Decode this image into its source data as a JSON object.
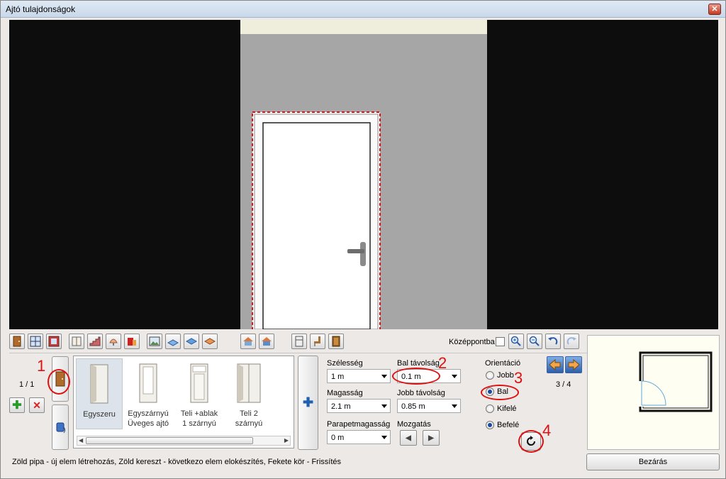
{
  "window": {
    "title": "Ajtó tulajdonságok",
    "close_glyph": "✕"
  },
  "toolbar": {
    "icons": [
      "door-icon",
      "window-icon",
      "bay-window-icon",
      "cabinet-icon",
      "stairs-icon",
      "lamp-icon",
      "furniture-icon",
      "picture-icon",
      "floor-tile-icon",
      "ceiling-tile-icon",
      "wall-tile-icon",
      "roof-icon",
      "roof-window-icon",
      "fridge-icon",
      "chair-icon",
      "door-small-icon"
    ],
    "center_label": "Középpontba",
    "center_checked": false,
    "right_icons": [
      "zoom-in-icon",
      "zoom-out-icon",
      "undo-icon",
      "redo-icon"
    ]
  },
  "left_panel": {
    "counter": "1 / 1",
    "add_icon": "plus-icon",
    "delete_icon": "delete-x-icon"
  },
  "gallery": {
    "items": [
      {
        "label": "Egyszeru",
        "selected": true
      },
      {
        "label": "Egyszárnyú\nÜveges ajtó",
        "selected": false
      },
      {
        "label": "Teli +ablak\n1 szárnyú",
        "selected": false
      },
      {
        "label": "Teli 2\nszárnyú",
        "selected": false
      }
    ]
  },
  "fields": {
    "width_label": "Szélesség",
    "width_value": "1 m",
    "left_dist_label": "Bal távolság",
    "left_dist_value": "0.1 m",
    "height_label": "Magasság",
    "height_value": "2.1 m",
    "right_dist_label": "Jobb távolság",
    "right_dist_value": "0.85 m",
    "sill_label": "Parapetmagasság",
    "sill_value": "0 m",
    "move_label": "Mozgatás"
  },
  "orientation": {
    "title": "Orientáció",
    "options": [
      {
        "label": "Jobb",
        "checked": false
      },
      {
        "label": "Bal",
        "checked": true
      },
      {
        "label": "Kifelé",
        "checked": false
      },
      {
        "label": "Befelé",
        "checked": true
      }
    ]
  },
  "nav": {
    "counter": "3 / 4"
  },
  "callouts": {
    "c1": "1",
    "c2": "2",
    "c3": "3",
    "c4": "4"
  },
  "status": {
    "text": "Zöld pipa - új elem létrehozás, Zöld kereszt - következo elem elokészítés, Fekete kör - Frissítés"
  },
  "close_button": "Bezárás"
}
